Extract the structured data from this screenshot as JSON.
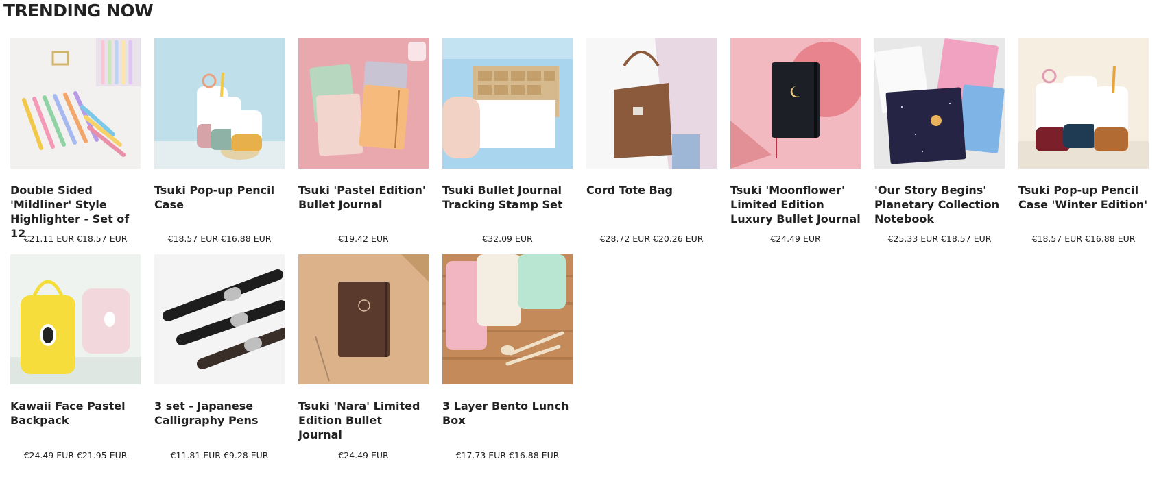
{
  "section": {
    "title": "TRENDING NOW"
  },
  "products": [
    {
      "title": "Double Sided 'Mildliner' Style Highlighter - Set of 12",
      "price": "€21.11 EUR €18.57 EUR",
      "image": "highlighter-pens-image"
    },
    {
      "title": "Tsuki Pop-up Pencil Case",
      "price": "€18.57 EUR €16.88 EUR",
      "image": "pencil-case-image"
    },
    {
      "title": "Tsuki 'Pastel Edition' Bullet Journal",
      "price": "€19.42 EUR",
      "image": "pastel-journals-image"
    },
    {
      "title": "Tsuki Bullet Journal Tracking Stamp Set",
      "price": "€32.09 EUR",
      "image": "stamp-set-image"
    },
    {
      "title": "Cord Tote Bag",
      "price": "€28.72 EUR €20.26 EUR",
      "image": "tote-bag-image"
    },
    {
      "title": "Tsuki 'Moonflower' Limited Edition Luxury Bullet Journal",
      "price": "€24.49 EUR",
      "image": "moonflower-journal-image"
    },
    {
      "title": "'Our Story Begins' Planetary Collection Notebook",
      "price": "€25.33 EUR €18.57 EUR",
      "image": "planetary-notebook-image"
    },
    {
      "title": "Tsuki Pop-up Pencil Case 'Winter Edition'",
      "price": "€18.57 EUR €16.88 EUR",
      "image": "winter-pencil-case-image"
    },
    {
      "title": "Kawaii Face Pastel Backpack",
      "price": "€24.49 EUR €21.95 EUR",
      "image": "backpack-image"
    },
    {
      "title": "3 set - Japanese Calligraphy Pens",
      "price": "€11.81 EUR €9.28 EUR",
      "image": "calligraphy-pens-image"
    },
    {
      "title": "Tsuki 'Nara' Limited Edition Bullet Journal",
      "price": "€24.49 EUR",
      "image": "nara-journal-image"
    },
    {
      "title": "3 Layer Bento Lunch Box",
      "price": "€17.73 EUR €16.88 EUR",
      "image": "bento-box-image"
    }
  ]
}
